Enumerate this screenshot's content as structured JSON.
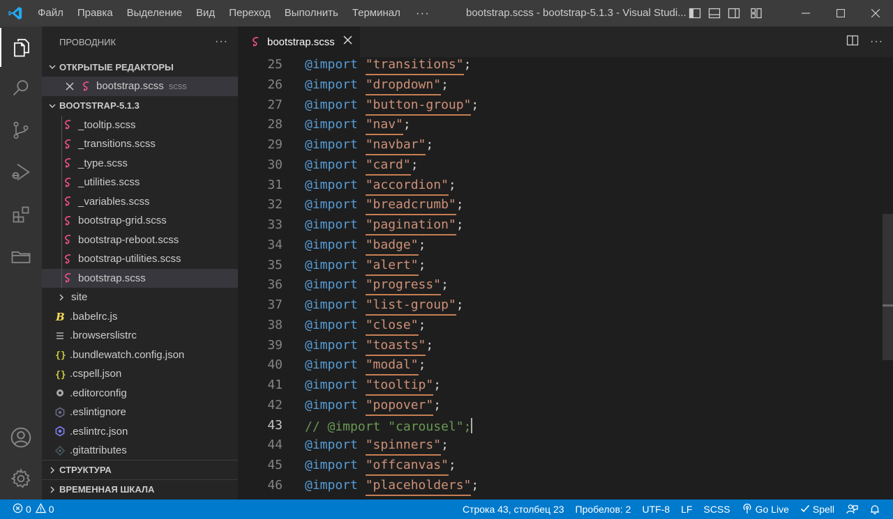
{
  "titlebar": {
    "menu": [
      "Файл",
      "Правка",
      "Выделение",
      "Вид",
      "Переход",
      "Выполнить",
      "Терминал"
    ],
    "more": "···",
    "title": "bootstrap.scss - bootstrap-5.1.3 - Visual Studi..."
  },
  "sidebar": {
    "title": "ПРОВОДНИК",
    "more": "···",
    "open_editors": {
      "label": "ОТКРЫТЫЕ РЕДАКТОРЫ",
      "items": [
        {
          "name": "bootstrap.scss",
          "detail": "scss"
        }
      ]
    },
    "project": {
      "label": "BOOTSTRAP-5.1.3",
      "scss_files": [
        "_tooltip.scss",
        "_transitions.scss",
        "_type.scss",
        "_utilities.scss",
        "_variables.scss",
        "bootstrap-grid.scss",
        "bootstrap-reboot.scss",
        "bootstrap-utilities.scss",
        "bootstrap.scss"
      ],
      "selected": "bootstrap.scss",
      "root_items": [
        {
          "name": "site",
          "icon": "chevron-right-icon"
        },
        {
          "name": ".babelrc.js",
          "icon": "babel-icon"
        },
        {
          "name": ".browserslistrc",
          "icon": "list-file-icon"
        },
        {
          "name": ".bundlewatch.config.json",
          "icon": "json-braces-icon"
        },
        {
          "name": ".cspell.json",
          "icon": "json-braces-icon"
        },
        {
          "name": ".editorconfig",
          "icon": "gear-icon"
        },
        {
          "name": ".eslintignore",
          "icon": "eslint-icon"
        },
        {
          "name": ".eslintrc.json",
          "icon": "eslint-icon"
        },
        {
          "name": ".gitattributes",
          "icon": "git-icon"
        }
      ]
    },
    "outline": "СТРУКТУРА",
    "timeline": "ВРЕМЕННАЯ ШКАЛА"
  },
  "editor": {
    "tab": "bootstrap.scss",
    "current_line": 43,
    "lines": [
      {
        "n": "25",
        "kw": "@import",
        "str": "\"transitions\""
      },
      {
        "n": "26",
        "kw": "@import",
        "str": "\"dropdown\""
      },
      {
        "n": "27",
        "kw": "@import",
        "str": "\"button-group\""
      },
      {
        "n": "28",
        "kw": "@import",
        "str": "\"nav\""
      },
      {
        "n": "29",
        "kw": "@import",
        "str": "\"navbar\""
      },
      {
        "n": "30",
        "kw": "@import",
        "str": "\"card\""
      },
      {
        "n": "31",
        "kw": "@import",
        "str": "\"accordion\""
      },
      {
        "n": "32",
        "kw": "@import",
        "str": "\"breadcrumb\""
      },
      {
        "n": "33",
        "kw": "@import",
        "str": "\"pagination\""
      },
      {
        "n": "34",
        "kw": "@import",
        "str": "\"badge\""
      },
      {
        "n": "35",
        "kw": "@import",
        "str": "\"alert\""
      },
      {
        "n": "36",
        "kw": "@import",
        "str": "\"progress\""
      },
      {
        "n": "37",
        "kw": "@import",
        "str": "\"list-group\""
      },
      {
        "n": "38",
        "kw": "@import",
        "str": "\"close\""
      },
      {
        "n": "39",
        "kw": "@import",
        "str": "\"toasts\""
      },
      {
        "n": "40",
        "kw": "@import",
        "str": "\"modal\""
      },
      {
        "n": "41",
        "kw": "@import",
        "str": "\"tooltip\""
      },
      {
        "n": "42",
        "kw": "@import",
        "str": "\"popover\""
      },
      {
        "n": "43",
        "comment": "// @import \"carousel\";"
      },
      {
        "n": "44",
        "kw": "@import",
        "str": "\"spinners\""
      },
      {
        "n": "45",
        "kw": "@import",
        "str": "\"offcanvas\""
      },
      {
        "n": "46",
        "kw": "@import",
        "str": "\"placeholders\""
      }
    ]
  },
  "statusbar": {
    "errors": "0",
    "warnings": "0",
    "position": "Строка 43, столбец 23",
    "spaces": "Пробелов: 2",
    "encoding": "UTF-8",
    "eol": "LF",
    "language": "SCSS",
    "golive": "Go Live",
    "spell": "Spell"
  },
  "colors": {
    "accent": "#007acc",
    "keyword": "#569cd6",
    "string": "#ce9178",
    "comment": "#6a9955",
    "sass": "#f55385"
  }
}
